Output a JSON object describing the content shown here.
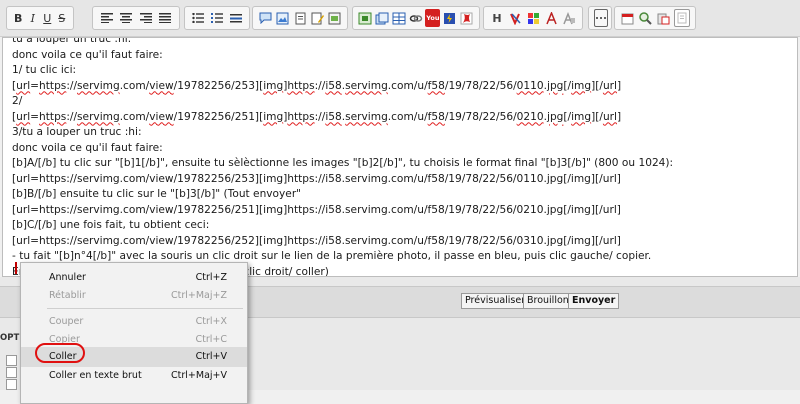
{
  "toolbar": {
    "icons": [
      "bold-icon",
      "italic-icon",
      "underline-icon",
      "strikethrough-icon",
      "align-left-icon",
      "align-center-icon",
      "align-right-icon",
      "justify-icon",
      "bullet-list-icon",
      "numbered-list-icon",
      "horizontal-rule-icon",
      "speech-bubble-icon",
      "image-icon",
      "note-icon",
      "edit-note-icon",
      "image-upload-icon",
      "gallery-icon",
      "table-icon",
      "link-icon",
      "youtube-icon",
      "flash-icon",
      "flag-icon",
      "heading-icon",
      "strike-color-icon",
      "color-palette-icon",
      "font-icon",
      "more-icon",
      "calendar-icon",
      "zoom-icon",
      "paste-icon",
      "page-icon"
    ],
    "labels": {
      "bold": "B",
      "italic": "I",
      "underline": "U",
      "strike": "S",
      "heading": "H",
      "youtube": "You"
    }
  },
  "editor": {
    "lines": [
      [
        {
          "t": "tu a louper un truc :hi:"
        }
      ],
      [
        {
          "t": "donc voila ce qu'il faut faire:"
        }
      ],
      [
        {
          "t": "1/ tu clic ici:"
        }
      ],
      [
        {
          "t": "["
        },
        {
          "t": "url",
          "w": 1
        },
        {
          "t": "="
        },
        {
          "t": "https",
          "w": 1
        },
        {
          "t": "://"
        },
        {
          "t": "servimg",
          "w": 1
        },
        {
          "t": ".com/"
        },
        {
          "t": "view",
          "w": 1
        },
        {
          "t": "/19782256/253]["
        },
        {
          "t": "img",
          "w": 1
        },
        {
          "t": "]"
        },
        {
          "t": "https",
          "w": 1
        },
        {
          "t": "://"
        },
        {
          "t": "i58",
          "w": 1
        },
        {
          "t": "."
        },
        {
          "t": "servimg",
          "w": 1
        },
        {
          "t": ".com/u/"
        },
        {
          "t": "f58",
          "w": 1
        },
        {
          "t": "/19/78/22/56/"
        },
        {
          "t": "0110",
          "w": 1
        },
        {
          "t": "."
        },
        {
          "t": "jpg",
          "w": 1
        },
        {
          "t": "[/"
        },
        {
          "t": "img",
          "w": 1
        },
        {
          "t": "][/"
        },
        {
          "t": "url",
          "w": 1
        },
        {
          "t": "]"
        }
      ],
      [
        {
          "t": "2/"
        }
      ],
      [
        {
          "t": "["
        },
        {
          "t": "url",
          "w": 1
        },
        {
          "t": "="
        },
        {
          "t": "https",
          "w": 1
        },
        {
          "t": "://"
        },
        {
          "t": "servimg",
          "w": 1
        },
        {
          "t": ".com/"
        },
        {
          "t": "view",
          "w": 1
        },
        {
          "t": "/19782256/251]["
        },
        {
          "t": "img",
          "w": 1
        },
        {
          "t": "]"
        },
        {
          "t": "https",
          "w": 1
        },
        {
          "t": "://"
        },
        {
          "t": "i58",
          "w": 1
        },
        {
          "t": "."
        },
        {
          "t": "servimg",
          "w": 1
        },
        {
          "t": ".com/u/"
        },
        {
          "t": "f58",
          "w": 1
        },
        {
          "t": "/19/78/22/56/"
        },
        {
          "t": "0210",
          "w": 1
        },
        {
          "t": "."
        },
        {
          "t": "jpg",
          "w": 1
        },
        {
          "t": "[/"
        },
        {
          "t": "img",
          "w": 1
        },
        {
          "t": "][/"
        },
        {
          "t": "url",
          "w": 1
        },
        {
          "t": "]"
        }
      ],
      [
        {
          "t": "3/tu a louper un truc :hi:"
        }
      ],
      [
        {
          "t": "donc voila ce qu'il faut faire:"
        }
      ],
      [
        {
          "t": "[b]A/[/b] tu clic sur \"[b]1[/b]\", ensuite tu sèlèctionne les images \"[b]2[/b]\", tu choisis le format final \"[b]3[/b]\" (800 ou 1024):"
        }
      ],
      [
        {
          "t": "[url=https://servimg.com/view/19782256/253][img]https://i58.servimg.com/u/f58/19/78/22/56/0110.jpg[/img][/url]"
        }
      ],
      [
        {
          "t": "[b]B/[/b] ensuite tu clic sur le \"[b]3[/b]\" (Tout envoyer\""
        }
      ],
      [
        {
          "t": "[url=https://servimg.com/view/19782256/251][img]https://i58.servimg.com/u/f58/19/78/22/56/0210.jpg[/img][/url]"
        }
      ],
      [
        {
          "t": "[b]C/[/b] une fois fait, tu obtient ceci:"
        }
      ],
      [
        {
          "t": "[url=https://servimg.com/view/19782256/252][img]https://i58.servimg.com/u/f58/19/78/22/56/0310.jpg[/img][/url]"
        }
      ],
      [
        {
          "t": "- tu fait \"[b]n°4[/b]\" avec la souris un clic droit sur le lien de la première photo, il passe en bleu, puis clic gauche/ copier."
        }
      ],
      [
        {
          "t": "Ensuite dans ton message tu fait un coller (clic droit/ coller)"
        }
      ]
    ]
  },
  "footer": {
    "preview_label": "Prévisualiser",
    "draft_label": "Brouillon",
    "send_label": "Envoyer",
    "options_label": "OPTI"
  },
  "context_menu": {
    "items": [
      {
        "label": "Annuler",
        "shortcut": "Ctrl+Z",
        "enabled": true
      },
      {
        "label": "Rétablir",
        "shortcut": "Ctrl+Maj+Z",
        "enabled": false
      },
      {
        "label": "Couper",
        "shortcut": "Ctrl+X",
        "enabled": false
      },
      {
        "label": "Copier",
        "shortcut": "Ctrl+C",
        "enabled": false
      },
      {
        "label": "Coller",
        "shortcut": "Ctrl+V",
        "enabled": true
      },
      {
        "label": "Coller en texte brut",
        "shortcut": "Ctrl+Maj+V",
        "enabled": true
      }
    ],
    "highlight_color": "#e01010"
  }
}
